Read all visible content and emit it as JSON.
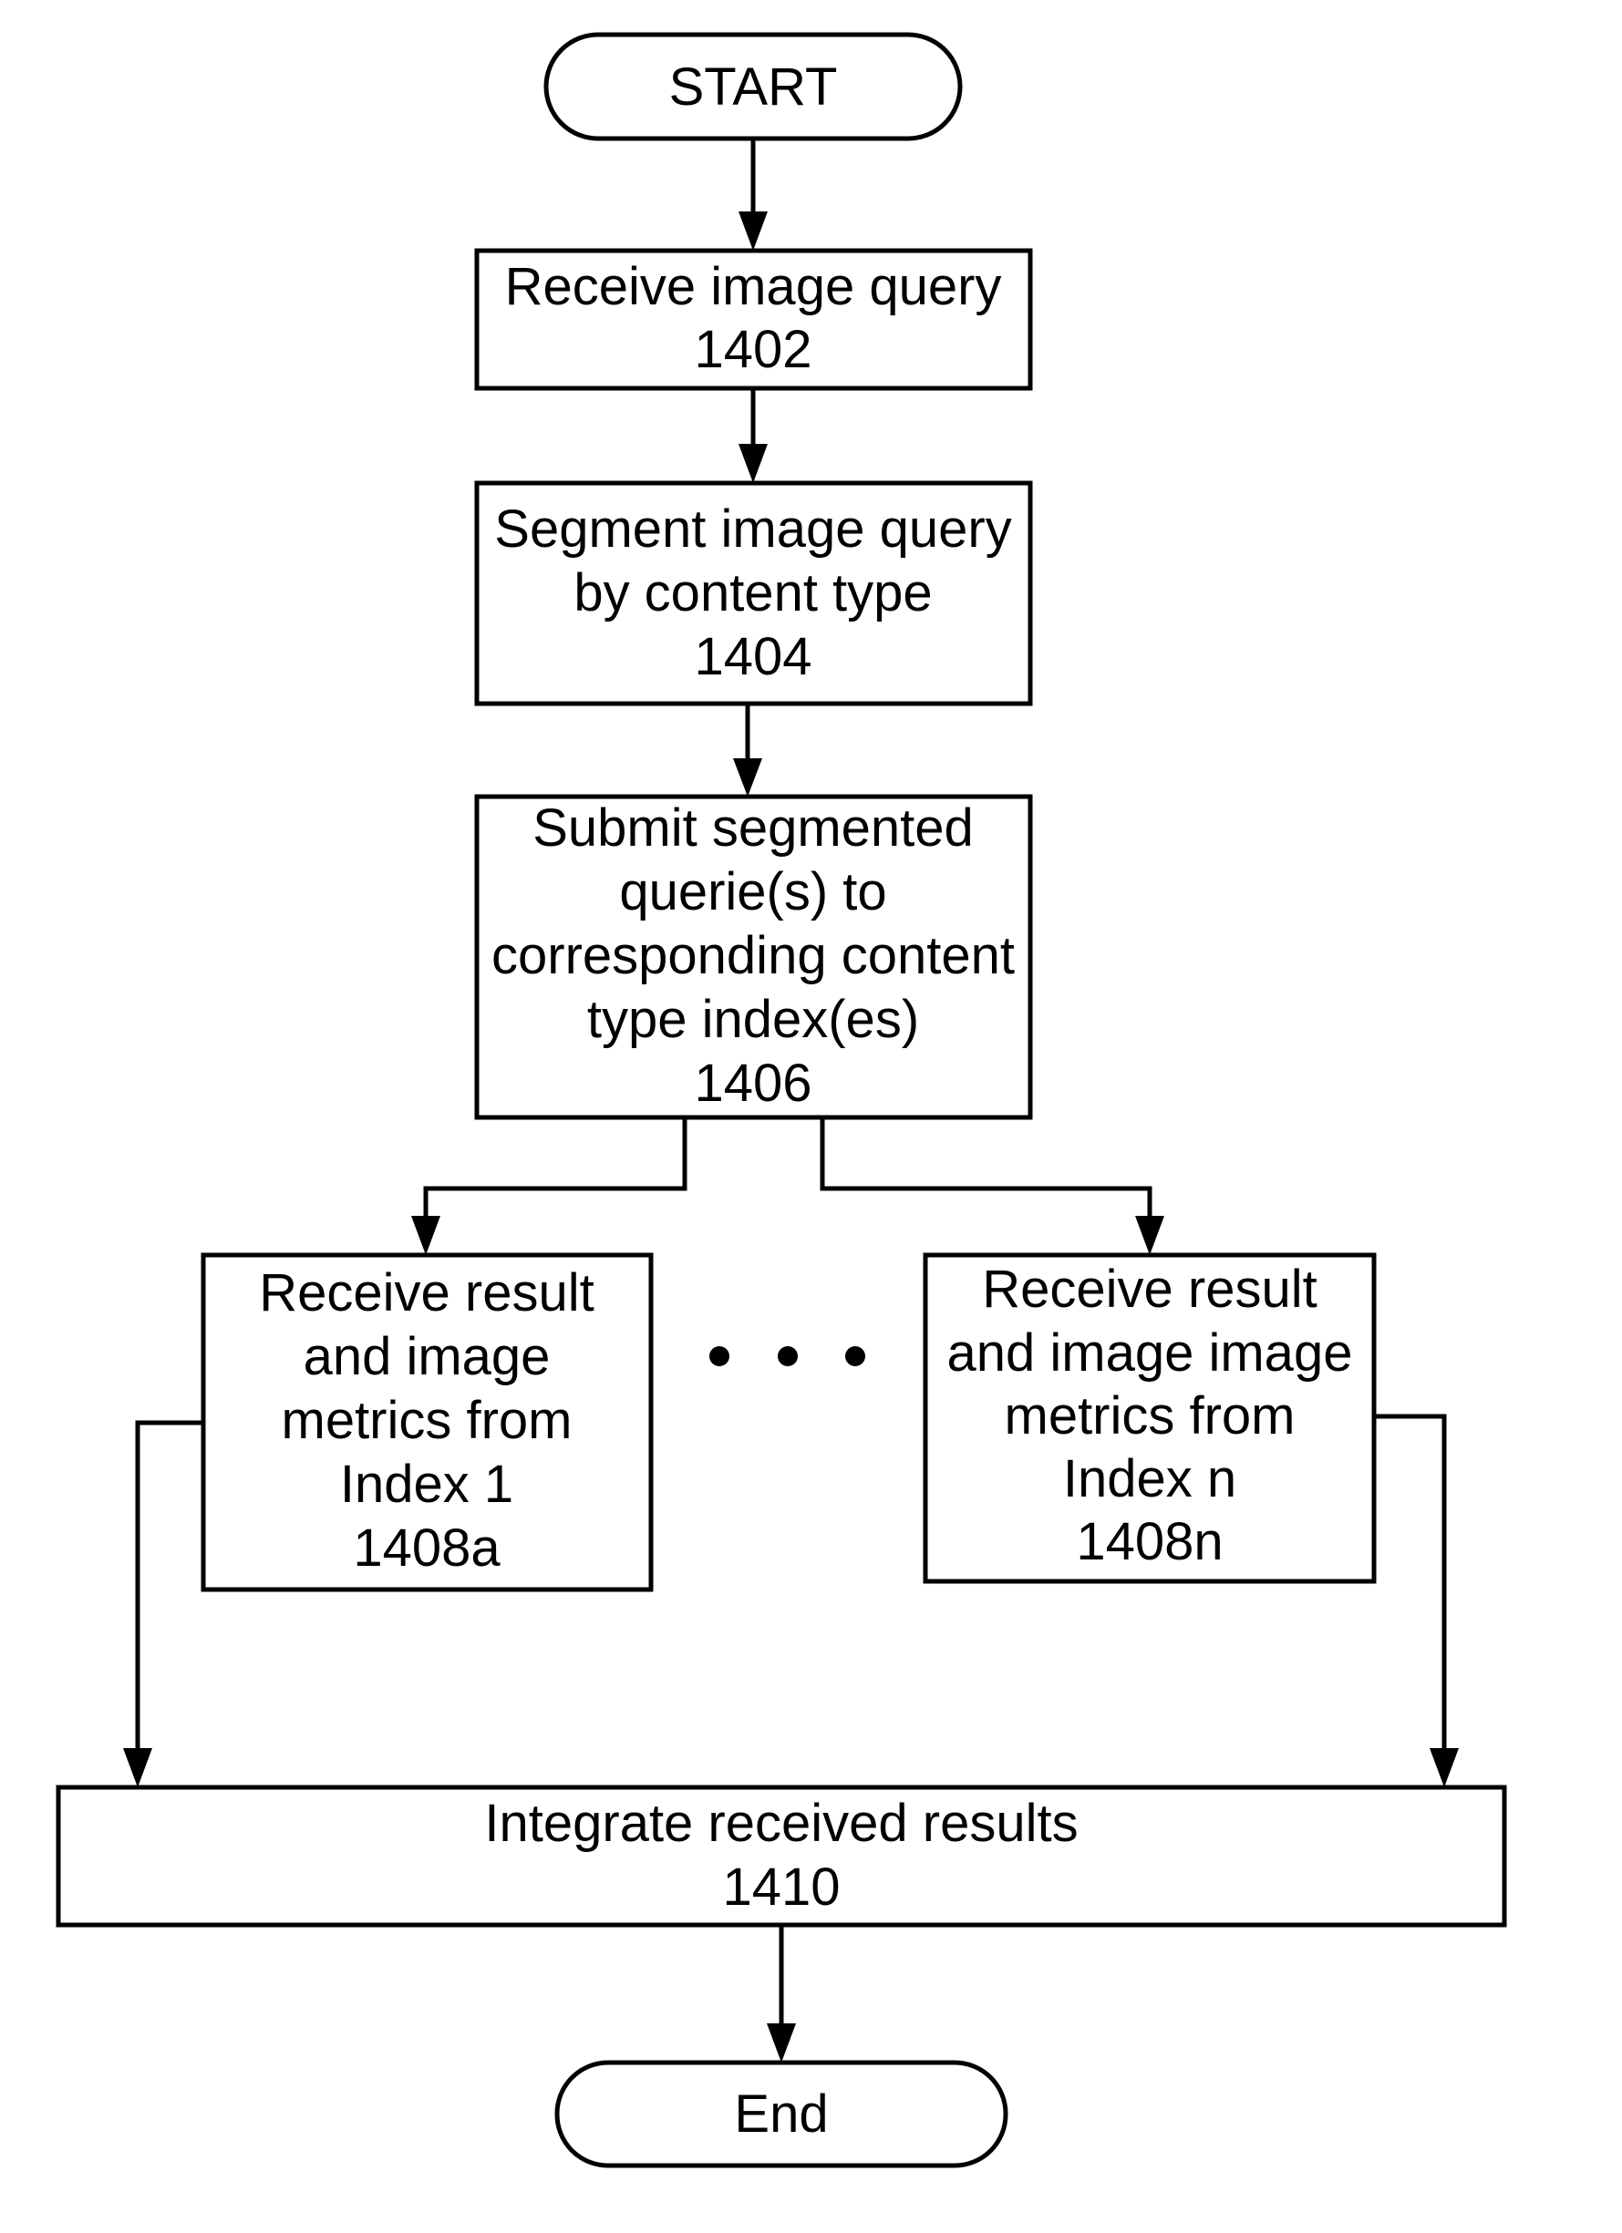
{
  "diagram": {
    "type": "flowchart",
    "start": {
      "label": "START"
    },
    "steps": [
      {
        "id": "1402",
        "lines": [
          "Receive image query",
          "1402"
        ]
      },
      {
        "id": "1404",
        "lines": [
          "Segment image query",
          "by content type",
          "1404"
        ]
      },
      {
        "id": "1406",
        "lines": [
          "Submit segmented",
          "querie(s) to",
          "corresponding content",
          "type index(es)",
          "1406"
        ]
      },
      {
        "id": "1408a",
        "lines": [
          "Receive result",
          "and image",
          "metrics from",
          "Index 1",
          "1408a"
        ]
      },
      {
        "id": "1408n",
        "lines": [
          "Receive result",
          "and image image",
          "metrics from",
          "Index n",
          "1408n"
        ]
      },
      {
        "id": "1410",
        "lines": [
          "Integrate received results",
          "1410"
        ]
      }
    ],
    "ellipsis": "• • •",
    "end": {
      "label": "End"
    },
    "colors": {
      "stroke": "#000000",
      "background": "#ffffff"
    }
  }
}
